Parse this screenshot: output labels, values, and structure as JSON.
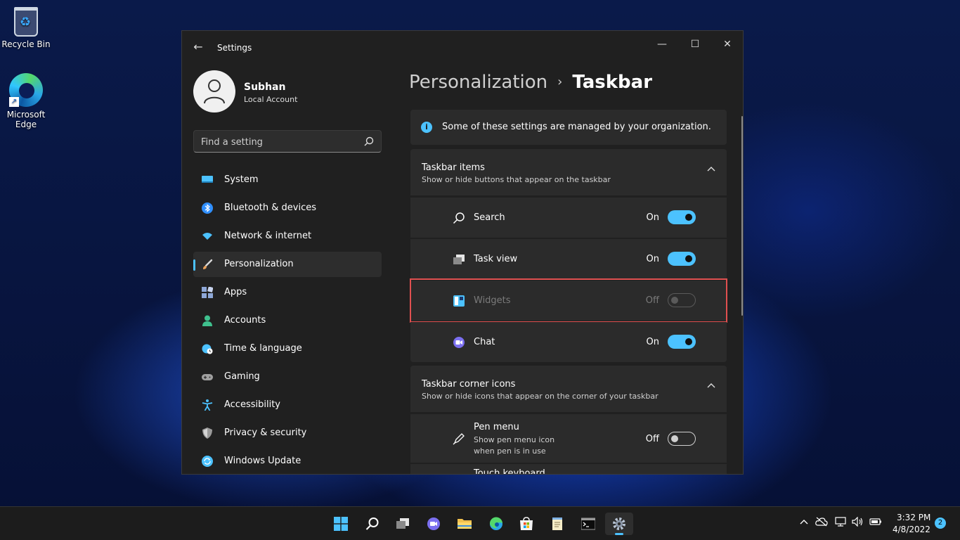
{
  "desktop": {
    "recycle_bin": "Recycle Bin",
    "edge_line1": "Microsoft",
    "edge_line2": "Edge"
  },
  "window": {
    "title": "Settings",
    "controls": {
      "minimize": "—",
      "maximize": "☐",
      "close": "✕"
    }
  },
  "profile": {
    "name": "Subhan",
    "account_type": "Local Account"
  },
  "search": {
    "placeholder": "Find a setting"
  },
  "nav": [
    {
      "label": "System",
      "icon": "monitor-icon",
      "color": "#4cc2ff"
    },
    {
      "label": "Bluetooth & devices",
      "icon": "bluetooth-icon",
      "color": "#2f8fff"
    },
    {
      "label": "Network & internet",
      "icon": "wifi-icon",
      "color": "#4cc2ff"
    },
    {
      "label": "Personalization",
      "icon": "brush-icon",
      "color": "#e8a15c",
      "active": true
    },
    {
      "label": "Apps",
      "icon": "apps-icon",
      "color": "#8ea8d8"
    },
    {
      "label": "Accounts",
      "icon": "person-icon",
      "color": "#3fc18e"
    },
    {
      "label": "Time & language",
      "icon": "globe-clock-icon",
      "color": "#4cc2ff"
    },
    {
      "label": "Gaming",
      "icon": "gamepad-icon",
      "color": "#a0a0a0"
    },
    {
      "label": "Accessibility",
      "icon": "accessibility-icon",
      "color": "#4cc2ff"
    },
    {
      "label": "Privacy & security",
      "icon": "shield-icon",
      "color": "#9a9a9a"
    },
    {
      "label": "Windows Update",
      "icon": "update-icon",
      "color": "#4cc2ff"
    }
  ],
  "breadcrumb": {
    "parent": "Personalization",
    "separator": "›",
    "current": "Taskbar"
  },
  "info": {
    "text": "Some of these settings are managed by your organization."
  },
  "taskbar_items": {
    "title": "Taskbar items",
    "subtitle": "Show or hide buttons that appear on the taskbar",
    "rows": [
      {
        "label": "Search",
        "state": "On"
      },
      {
        "label": "Task view",
        "state": "On"
      },
      {
        "label": "Widgets",
        "state": "Off"
      },
      {
        "label": "Chat",
        "state": "On"
      }
    ]
  },
  "corner_icons": {
    "title": "Taskbar corner icons",
    "subtitle": "Show or hide icons that appear on the corner of your taskbar",
    "pen": {
      "label": "Pen menu",
      "desc": "Show pen menu icon when pen is in use",
      "state": "Off"
    },
    "touch": {
      "label": "Touch keyboard"
    }
  },
  "clock": {
    "time": "3:32 PM",
    "date": "4/8/2022"
  },
  "notifications": {
    "count": "2"
  },
  "colors": {
    "accent": "#4cc2ff",
    "highlight": "#e05050",
    "window_bg": "#202020",
    "card_bg": "#2b2b2b"
  }
}
